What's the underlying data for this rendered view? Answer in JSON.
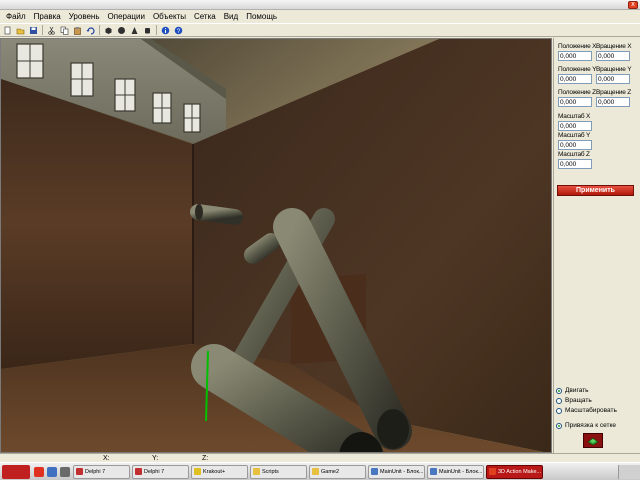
{
  "window": {
    "close": "x"
  },
  "menu": [
    "Файл",
    "Правка",
    "Уровень",
    "Операции",
    "Объекты",
    "Сетка",
    "Вид",
    "Помощь"
  ],
  "toolbar": [
    {
      "icon": "new-file-icon"
    },
    {
      "icon": "open-folder-icon"
    },
    {
      "icon": "save-icon"
    },
    {
      "icon": "cut-icon"
    },
    {
      "icon": "copy-icon"
    },
    {
      "icon": "paste-icon"
    },
    {
      "icon": "undo-icon"
    },
    {
      "icon": "box-object-icon"
    },
    {
      "icon": "sphere-object-icon"
    },
    {
      "icon": "cone-object-icon"
    },
    {
      "icon": "cylinder-object-icon"
    },
    {
      "icon": "info-icon"
    },
    {
      "icon": "help-icon"
    }
  ],
  "panel": {
    "pos_x_label": "Положение X",
    "rot_x_label": "Вращение X",
    "pos_x": "0,000",
    "rot_x": "0,000",
    "pos_y_label": "Положение Y",
    "rot_y_label": "Вращение Y",
    "pos_y": "0,000",
    "rot_y": "0,000",
    "pos_z_label": "Положение Z",
    "rot_z_label": "Вращение Z",
    "pos_z": "0,000",
    "rot_z": "0,000",
    "scale_x_label": "Масштаб X",
    "scale_x": "0,000",
    "scale_y_label": "Масштаб Y",
    "scale_y": "0,000",
    "scale_z_label": "Масштаб Z",
    "scale_z": "0,000",
    "apply": "Применить",
    "modes": [
      {
        "label": "Двигать",
        "selected": true
      },
      {
        "label": "Вращать",
        "selected": false
      },
      {
        "label": "Масштабировать",
        "selected": false
      }
    ],
    "snap": {
      "label": "Привязка к сетке",
      "selected": true
    }
  },
  "status": {
    "x_label": "X:",
    "y_label": "Y:",
    "z_label": "Z:"
  },
  "taskbar": {
    "tasks": [
      {
        "label": "Delphi 7",
        "icon_color": "#c03030"
      },
      {
        "label": "Delphi 7",
        "icon_color": "#c03030"
      },
      {
        "label": "Krakout+",
        "icon_color": "#e0c020"
      },
      {
        "label": "Scripts",
        "icon_color": "#e8c040"
      },
      {
        "label": "Game2",
        "icon_color": "#e8c040"
      },
      {
        "label": "MainUnit - Блок...",
        "icon_color": "#4a78c0"
      },
      {
        "label": "MainUnit - Блок...",
        "icon_color": "#4a78c0"
      },
      {
        "label": "3D Action Make...",
        "icon_color": "#e04020",
        "active": true
      }
    ]
  },
  "colors": {
    "apply_button": "#c82010",
    "accent_red": "#b81818",
    "axis_green": "#00c000"
  }
}
